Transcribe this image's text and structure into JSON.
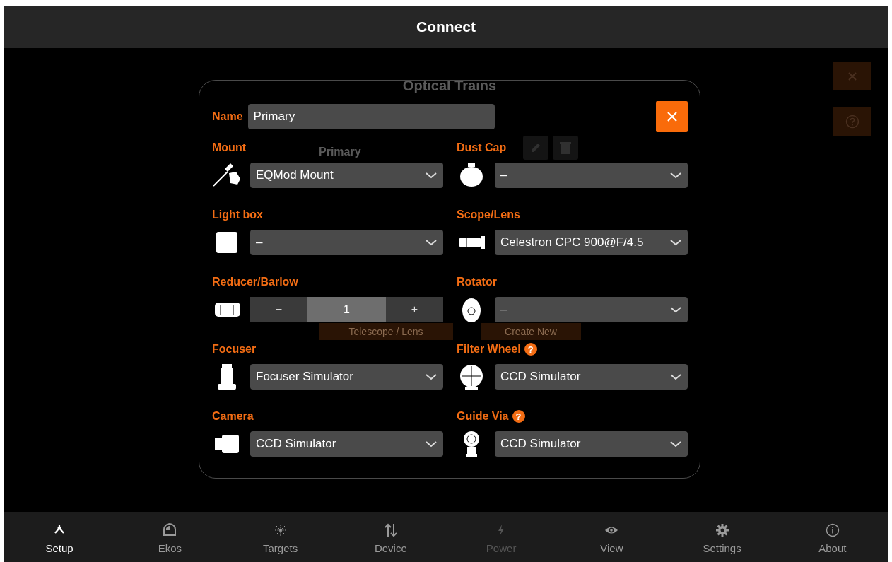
{
  "app_bar": {
    "title": "Connect"
  },
  "background": {
    "title": "Optical Trains",
    "train": "Primary",
    "buttons": [
      "Telescope / Lens",
      "Create New"
    ]
  },
  "dialog": {
    "name_label": "Name",
    "name_value": "Primary",
    "fields": [
      {
        "label": "Mount",
        "kind": "select",
        "value": "EQMod Mount",
        "help": false
      },
      {
        "label": "Dust Cap",
        "kind": "select",
        "value": "–",
        "help": false
      },
      {
        "label": "Light box",
        "kind": "select",
        "value": "–",
        "help": false
      },
      {
        "label": "Scope/Lens",
        "kind": "select",
        "value": "Celestron CPC 900@F/4.5",
        "help": false
      },
      {
        "label": "Reducer/Barlow",
        "kind": "stepper",
        "minus": "−",
        "value": "1",
        "plus": "+",
        "help": false
      },
      {
        "label": "Rotator",
        "kind": "select",
        "value": "–",
        "help": false
      },
      {
        "label": "Focuser",
        "kind": "select",
        "value": "Focuser Simulator",
        "help": false
      },
      {
        "label": "Filter Wheel",
        "kind": "select",
        "value": "CCD Simulator",
        "help": true
      },
      {
        "label": "Camera",
        "kind": "select",
        "value": "CCD Simulator",
        "help": false
      },
      {
        "label": "Guide Via",
        "kind": "select",
        "value": "CCD Simulator",
        "help": true
      }
    ],
    "help_glyph": "?"
  },
  "nav": [
    {
      "label": "Setup",
      "selected": true,
      "disabled": false
    },
    {
      "label": "Ekos",
      "selected": false,
      "disabled": false
    },
    {
      "label": "Targets",
      "selected": false,
      "disabled": false
    },
    {
      "label": "Device",
      "selected": false,
      "disabled": false
    },
    {
      "label": "Power",
      "selected": false,
      "disabled": true
    },
    {
      "label": "View",
      "selected": false,
      "disabled": false
    },
    {
      "label": "Settings",
      "selected": false,
      "disabled": false
    },
    {
      "label": "About",
      "selected": false,
      "disabled": false
    }
  ]
}
